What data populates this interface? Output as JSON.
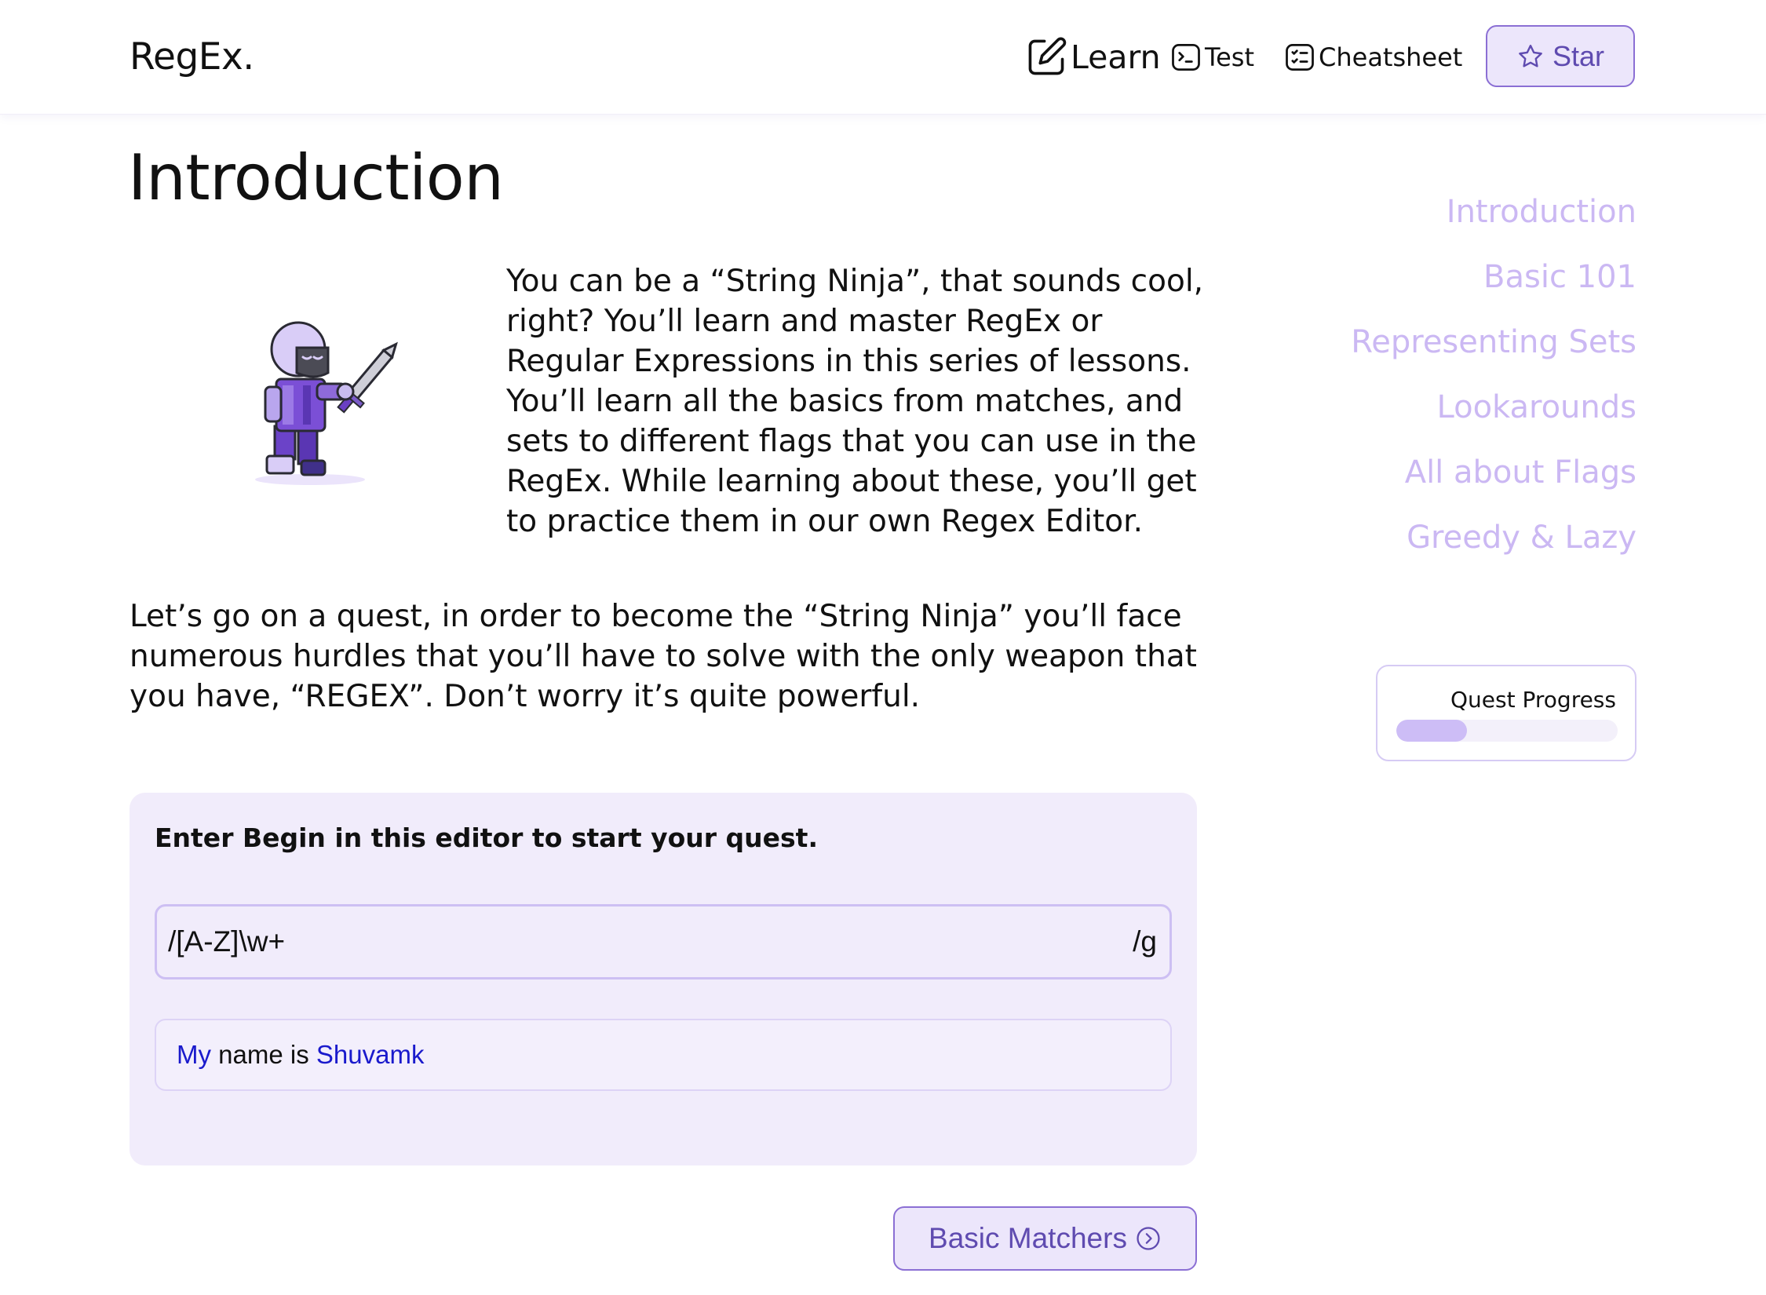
{
  "header": {
    "brand": "RegEx.",
    "nav": [
      {
        "label": "Learn",
        "icon": "pencil-square-icon"
      },
      {
        "label": "Test",
        "icon": "terminal-icon"
      },
      {
        "label": "Cheatsheet",
        "icon": "checklist-icon"
      }
    ],
    "star_label": "Star"
  },
  "main": {
    "title": "Introduction",
    "paragraph_1": "You can be a “String Ninja”, that sounds cool, right? You’ll learn and master RegEx or Regular Expressions in this series of lessons. You’ll learn all the basics from matches, and sets to different flags that you can use in the RegEx. While learning about these, you’ll get to practice them in our own Regex Editor.",
    "paragraph_2": "Let’s go on a quest, in order to become the “String Ninja” you’ll face numerous hurdles that you’ll have to solve with the only weapon that you have, “REGEX”. Don’t worry it’s quite powerful."
  },
  "editor": {
    "prompt": "Enter Begin in this editor to start your quest.",
    "regex_value": "/[A-Z]\\w+",
    "flag": "/g",
    "test_text": {
      "match_1": "My",
      "middle": " name is ",
      "match_2": "Shuvamk"
    }
  },
  "next_button": {
    "label": "Basic Matchers"
  },
  "toc": {
    "items": [
      "Introduction",
      "Basic 101",
      "Representing Sets",
      "Lookarounds",
      "All about Flags",
      "Greedy & Lazy"
    ]
  },
  "progress": {
    "label": "Quest Progress",
    "percent": 32
  },
  "colors": {
    "accent": "#8b6fd4",
    "accent_bg": "#ece6fb",
    "toc_text": "#cbb8f3",
    "match_text": "#1a1acc",
    "editor_bg": "#f1ecfb"
  }
}
